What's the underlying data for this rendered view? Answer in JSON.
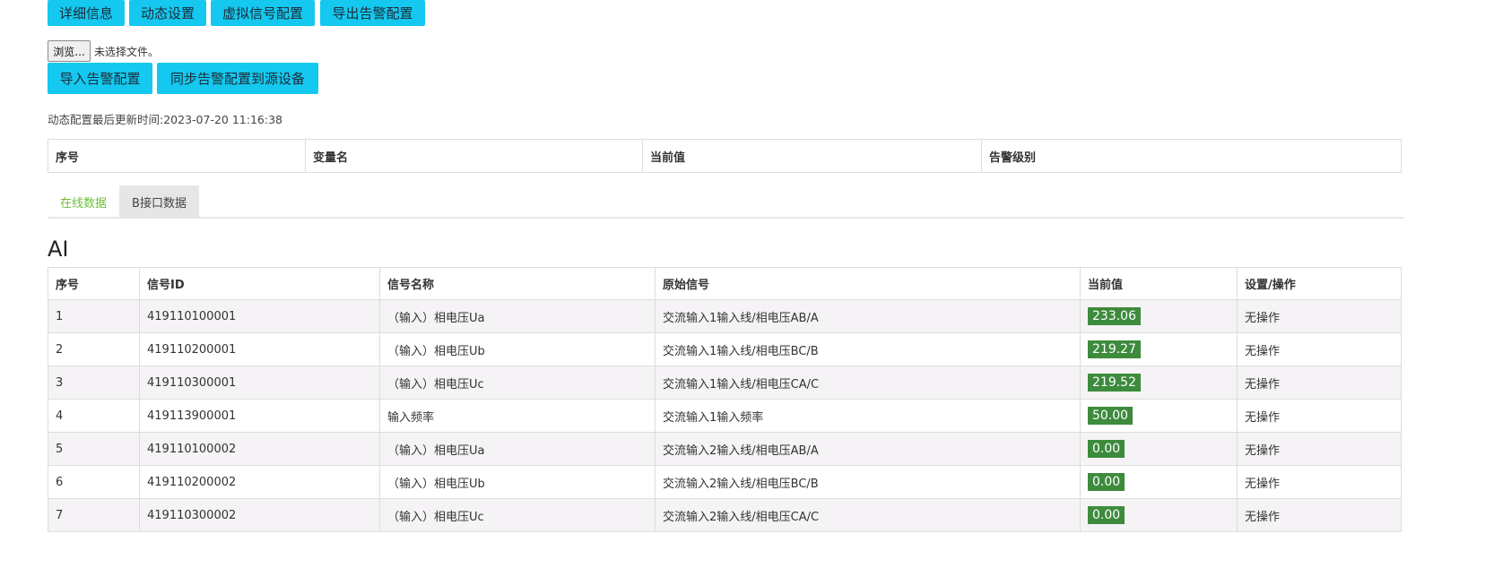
{
  "toolbar": {
    "details": "详细信息",
    "dynamic_settings": "动态设置",
    "virtual_signal_config": "虚拟信号配置",
    "export_alarm_config": "导出告警配置"
  },
  "file_input": {
    "browse_label": "浏览...",
    "status": "未选择文件。"
  },
  "actions": {
    "import_alarm_config": "导入告警配置",
    "sync_alarm_config": "同步告警配置到源设备"
  },
  "update_time": "动态配置最后更新时间:2023-07-20 11:16:38",
  "alarm_table": {
    "headers": [
      "序号",
      "变量名",
      "当前值",
      "告警级别"
    ]
  },
  "tabs": {
    "online": "在线数据",
    "b_interface": "B接口数据"
  },
  "section_title": "AI",
  "ai_table": {
    "headers": [
      "序号",
      "信号ID",
      "信号名称",
      "原始信号",
      "当前值",
      "设置/操作"
    ],
    "rows": [
      {
        "index": "1",
        "signal_id": "419110100001",
        "name": "（输入）相电压Ua",
        "source": "交流输入1输入线/相电压AB/A",
        "value": "233.06",
        "action": "无操作"
      },
      {
        "index": "2",
        "signal_id": "419110200001",
        "name": "（输入）相电压Ub",
        "source": "交流输入1输入线/相电压BC/B",
        "value": "219.27",
        "action": "无操作"
      },
      {
        "index": "3",
        "signal_id": "419110300001",
        "name": "（输入）相电压Uc",
        "source": "交流输入1输入线/相电压CA/C",
        "value": "219.52",
        "action": "无操作"
      },
      {
        "index": "4",
        "signal_id": "419113900001",
        "name": "输入频率",
        "source": "交流输入1输入频率",
        "value": "50.00",
        "action": "无操作"
      },
      {
        "index": "5",
        "signal_id": "419110100002",
        "name": "（输入）相电压Ua",
        "source": "交流输入2输入线/相电压AB/A",
        "value": "0.00",
        "action": "无操作"
      },
      {
        "index": "6",
        "signal_id": "419110200002",
        "name": "（输入）相电压Ub",
        "source": "交流输入2输入线/相电压BC/B",
        "value": "0.00",
        "action": "无操作"
      },
      {
        "index": "7",
        "signal_id": "419110300002",
        "name": "（输入）相电压Uc",
        "source": "交流输入2输入线/相电压CA/C",
        "value": "0.00",
        "action": "无操作"
      }
    ]
  },
  "colors": {
    "button": "#14c8f0",
    "value_badge": "#3d8b3d",
    "active_tab_text": "#6bbf3a"
  }
}
